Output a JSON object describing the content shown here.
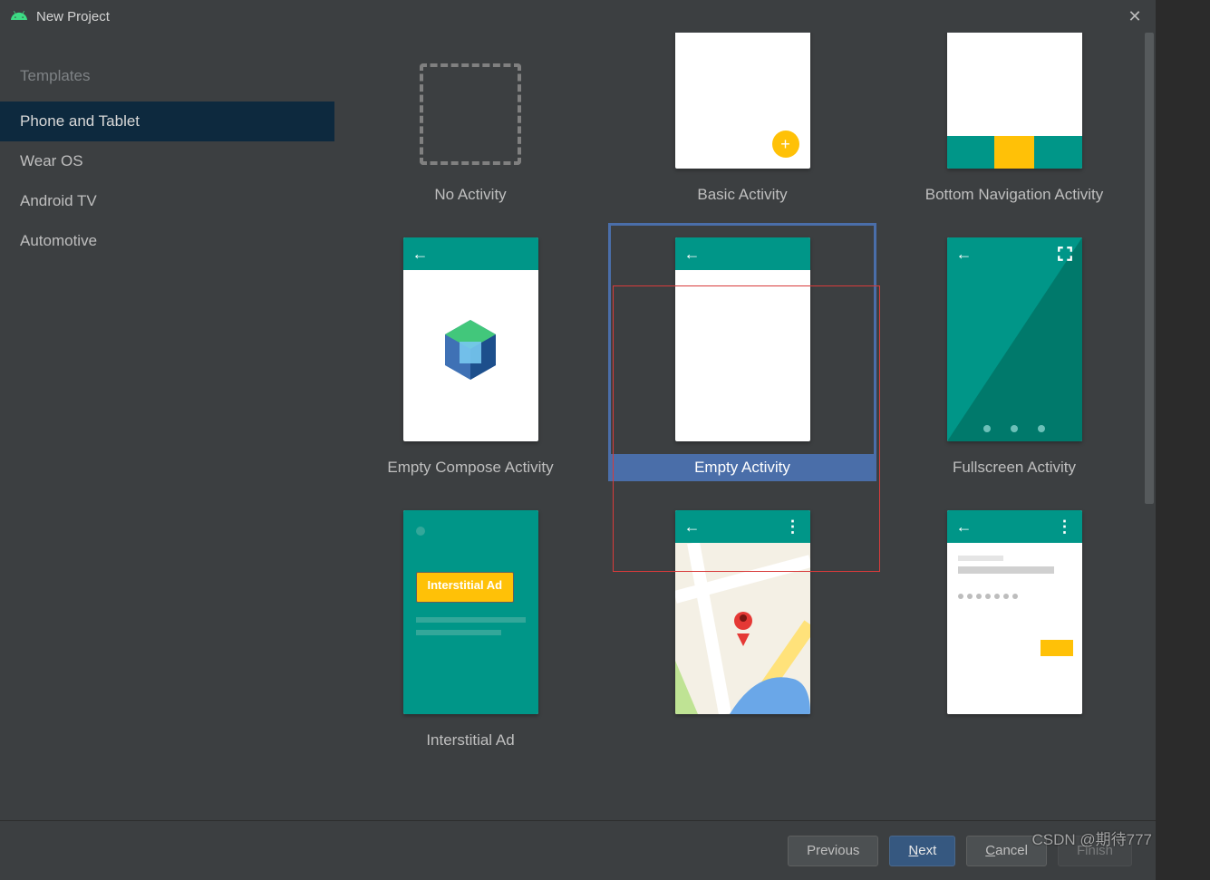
{
  "title": "New Project",
  "sidebar": {
    "heading": "Templates",
    "items": [
      {
        "label": "Phone and Tablet",
        "selected": true
      },
      {
        "label": "Wear OS",
        "selected": false
      },
      {
        "label": "Android TV",
        "selected": false
      },
      {
        "label": "Automotive",
        "selected": false
      }
    ]
  },
  "templates": [
    {
      "id": "no-activity",
      "label": "No Activity"
    },
    {
      "id": "basic",
      "label": "Basic Activity"
    },
    {
      "id": "bottomnav",
      "label": "Bottom Navigation Activity"
    },
    {
      "id": "compose",
      "label": "Empty Compose Activity"
    },
    {
      "id": "empty",
      "label": "Empty Activity",
      "selected": true
    },
    {
      "id": "fullscreen",
      "label": "Fullscreen Activity"
    },
    {
      "id": "ad",
      "label": "Interstitial Ad"
    },
    {
      "id": "map",
      "label": ""
    },
    {
      "id": "login",
      "label": ""
    }
  ],
  "ad_button_text": "Interstitial Ad",
  "buttons": {
    "previous": "Previous",
    "next": "Next",
    "cancel": "Cancel",
    "finish": "Finish"
  },
  "mnemonics": {
    "next": "N",
    "cancel": "C"
  },
  "watermark": "CSDN @期待777"
}
